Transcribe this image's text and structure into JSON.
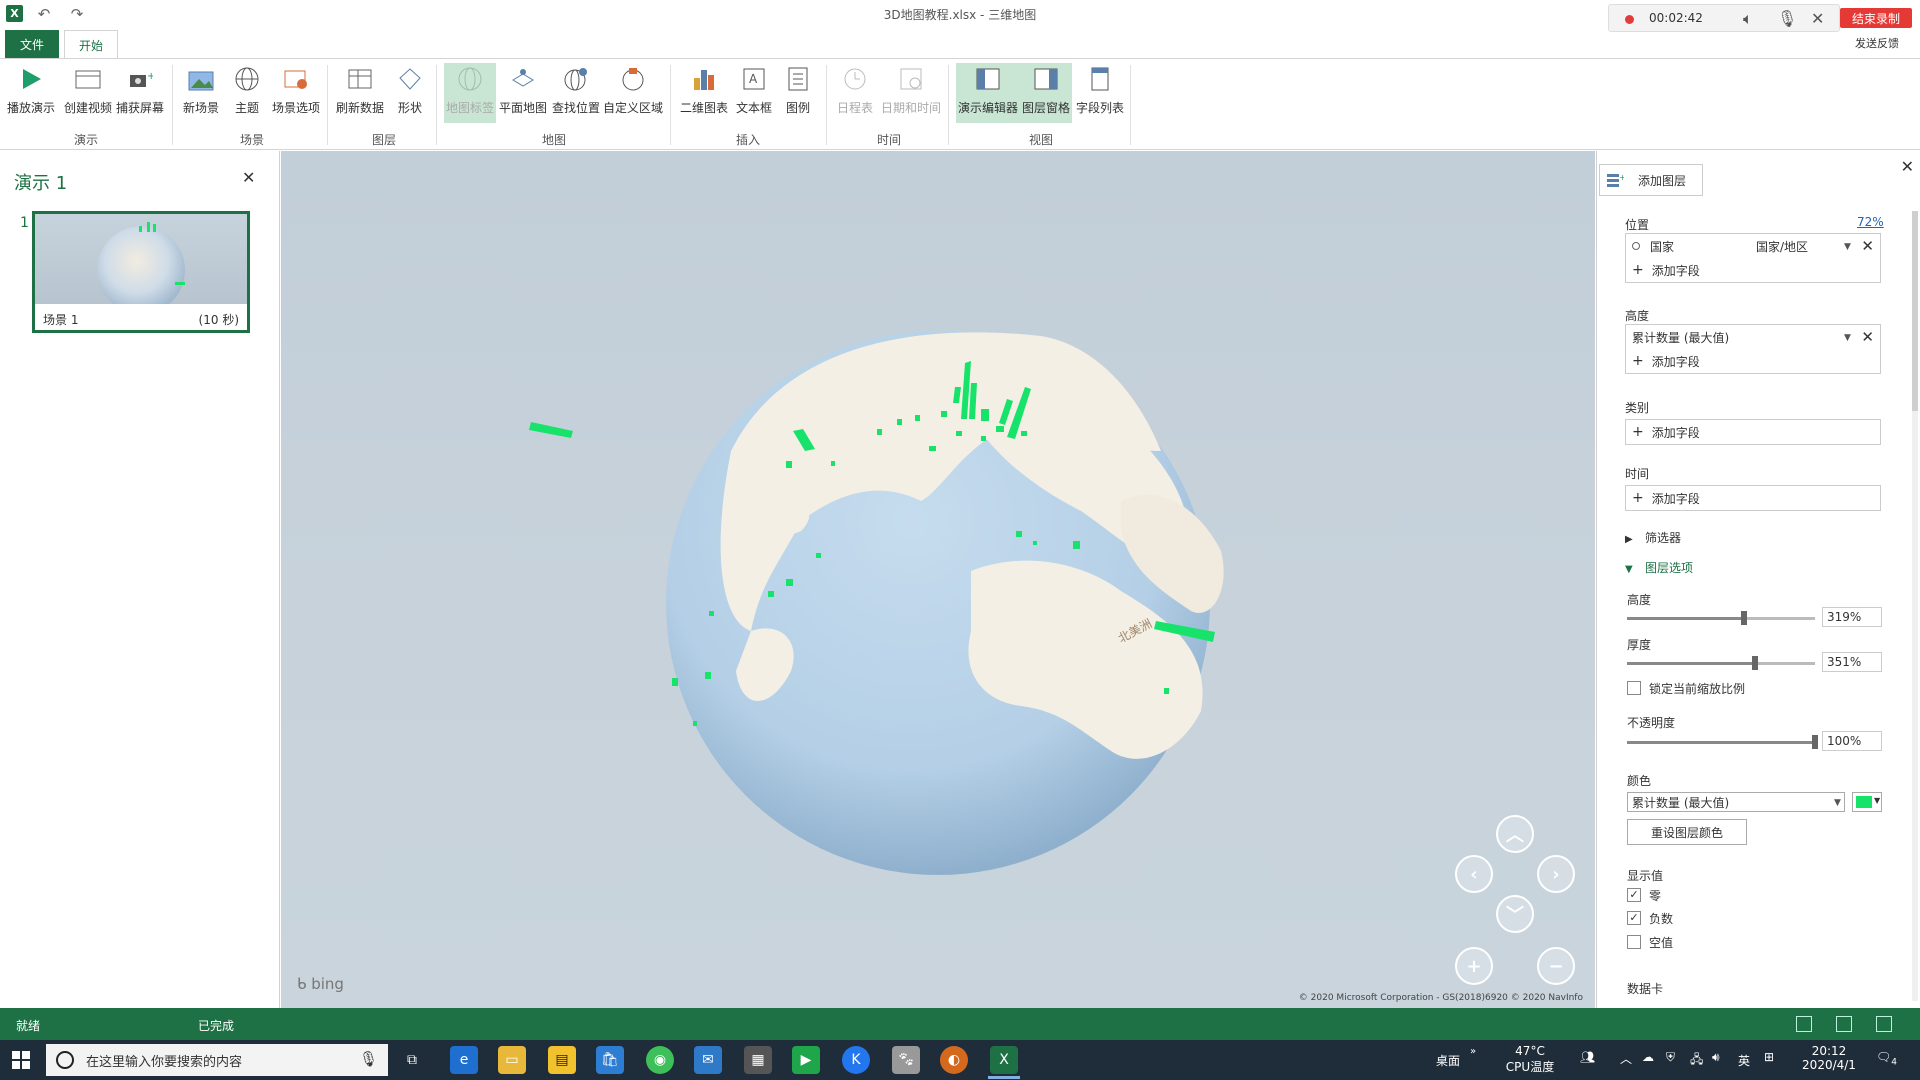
{
  "window": {
    "title": "3D地图教程.xlsx - 三维地图",
    "app_logo": "X",
    "undo_icon": "undo-icon",
    "redo_icon": "redo-icon"
  },
  "recorder": {
    "time": "00:02:42",
    "end_label": "结束录制",
    "feedback": "发送反馈"
  },
  "tabs": [
    {
      "label": "文件"
    },
    {
      "label": "开始"
    }
  ],
  "ribbon": {
    "groups": [
      {
        "label": "演示",
        "buttons": [
          "播放演示",
          "创建视频",
          "捕获屏幕"
        ]
      },
      {
        "label": "场景",
        "buttons": [
          "新场景",
          "主题",
          "场景选项"
        ]
      },
      {
        "label": "图层",
        "buttons": [
          "刷新数据",
          "形状"
        ]
      },
      {
        "label": "地图",
        "buttons": [
          "地图标签",
          "平面地图",
          "查找位置",
          "自定义区域"
        ]
      },
      {
        "label": "插入",
        "buttons": [
          "二维图表",
          "文本框",
          "图例"
        ]
      },
      {
        "label": "时间",
        "buttons": [
          "日程表",
          "日期和时间"
        ]
      },
      {
        "label": "视图",
        "buttons": [
          "演示编辑器",
          "图层窗格",
          "字段列表"
        ]
      }
    ]
  },
  "tour_pane": {
    "title": "演示 1",
    "scene_number": "1",
    "scene_name": "场景 1",
    "scene_duration": "(10 秒)"
  },
  "map": {
    "bing_label": "bing",
    "copyright": "© 2020 Microsoft Corporation - GS(2018)6920  © 2020 NavInfo",
    "continent_label": "北美洲"
  },
  "layer_pane": {
    "add_layer": "添加图层",
    "percent": "72%",
    "location": {
      "label": "位置",
      "field": "国家",
      "type": "国家/地区",
      "add_field": "添加字段"
    },
    "height": {
      "label": "高度",
      "field": "累计数量 (最大值)",
      "add_field": "添加字段"
    },
    "category": {
      "label": "类别",
      "add_field": "添加字段"
    },
    "time": {
      "label": "时间",
      "add_field": "添加字段"
    },
    "filters": "筛选器",
    "layer_options": "图层选项",
    "opt_height": {
      "label": "高度",
      "value": "319%",
      "level": 0.62
    },
    "opt_thickness": {
      "label": "厚度",
      "value": "351%",
      "level": 0.68
    },
    "lock_scale": "锁定当前缩放比例",
    "opacity": {
      "label": "不透明度",
      "value": "100%",
      "level": 1.0
    },
    "color": {
      "label": "颜色",
      "field": "累计数量 (最大值)",
      "swatch": "#17e36b"
    },
    "reset_color": "重设图层颜色",
    "show_values": {
      "label": "显示值",
      "zero": "零",
      "zero_checked": true,
      "negative": "负数",
      "negative_checked": true,
      "empty": "空值",
      "empty_checked": false
    },
    "data_card": "数据卡"
  },
  "statusbar": {
    "ready": "就绪",
    "done": "已完成"
  },
  "taskbar": {
    "search_placeholder": "在这里输入你要搜索的内容",
    "desktop": "桌面",
    "temp": "47°C",
    "temp_label": "CPU温度",
    "ime": "英",
    "time": "20:12",
    "date": "2020/4/1",
    "notif_count": "4"
  }
}
